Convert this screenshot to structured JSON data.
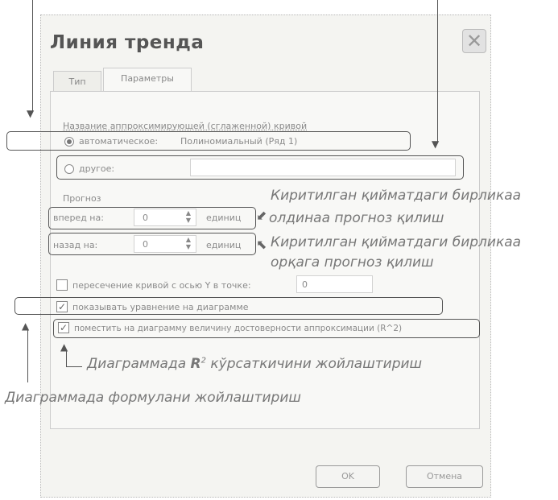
{
  "dialog": {
    "title": "Линия тренда",
    "close_glyph": "✕"
  },
  "tabs": [
    {
      "label": "Тип"
    },
    {
      "label": "Параметры"
    }
  ],
  "approx": {
    "group_label": "Название аппроксимирующей (сглаженной) кривой",
    "auto_label": "автоматическое:",
    "auto_value": "Полиномиальный (Ряд 1)",
    "other_label": "другое:",
    "other_value": ""
  },
  "forecast": {
    "group_label": "Прогноз",
    "forward_label": "вперед на:",
    "forward_value": "0",
    "backward_label": "назад на:",
    "backward_value": "0",
    "units_label": "единиц"
  },
  "options": {
    "intercept_label": "пересечение кривой с осью Y в точке:",
    "intercept_value": "0",
    "show_equation_label": "показывать уравнение на диаграмме",
    "show_r2_label": "поместить на диаграмму величину достоверности аппроксимации (R^2)"
  },
  "buttons": {
    "ok": "OK",
    "cancel": "Отмена"
  },
  "annotations": {
    "forward_1": "Киритилган қийматдаги бирликаа",
    "forward_2": "олдинаа прогноз қилиш",
    "backward_1": "Киритилган қийматдаги бирликаа",
    "backward_2": "орқага прогноз қилиш",
    "r2_prefix": "Диаграммада ",
    "r2_symbol": "R",
    "r2_sup": "2",
    "r2_suffix": " кўрсаткичини жойлаштириш",
    "formula": "Диаграммада формулани жойлаштириш"
  }
}
